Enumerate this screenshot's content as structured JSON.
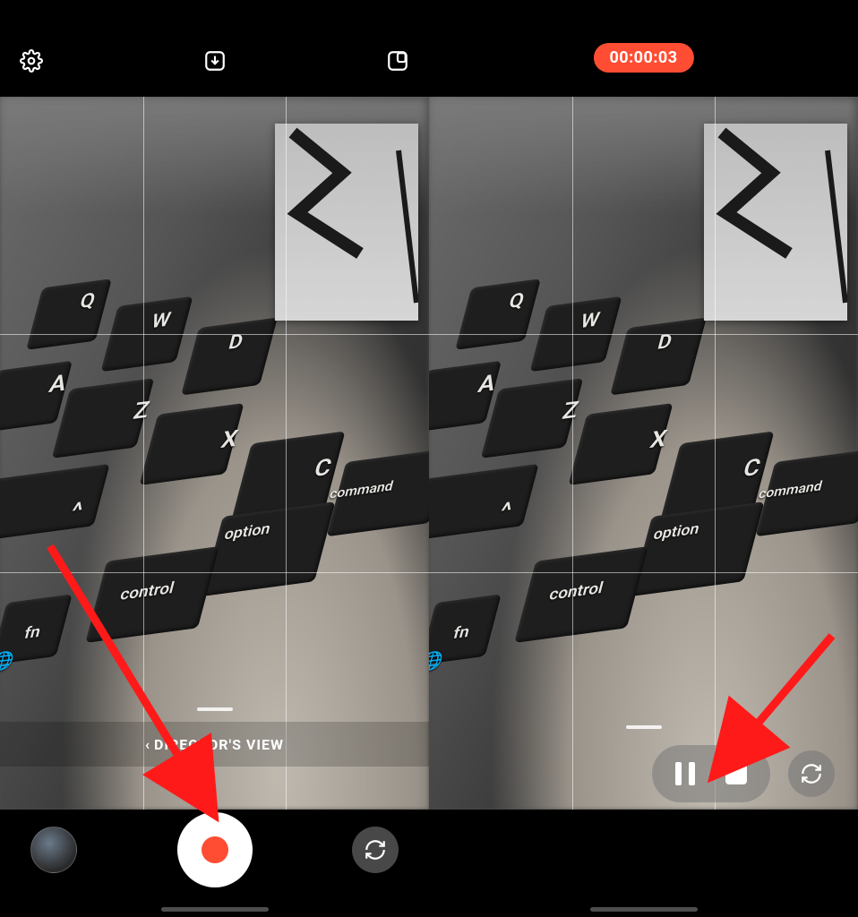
{
  "left": {
    "mode_label": "DIRECTOR'S VIEW",
    "icons": {
      "settings": "settings-icon",
      "download": "download-tray-icon",
      "pip_layout": "pip-layout-icon"
    },
    "controls": {
      "gallery_thumbnail": "gallery-thumbnail",
      "record": "record-button",
      "switch_camera": "switch-camera-button"
    }
  },
  "right": {
    "recording_time": "00:00:03",
    "controls": {
      "pause": "pause-button",
      "stop": "stop-button",
      "switch_camera": "switch-camera-button"
    }
  },
  "colors": {
    "accent_red": "#ff4d33",
    "white": "#ffffff",
    "pill_bg": "rgba(120,120,120,.55)"
  },
  "annotations": {
    "left_arrow_target": "record-button",
    "right_arrow_target": "stop-button"
  }
}
